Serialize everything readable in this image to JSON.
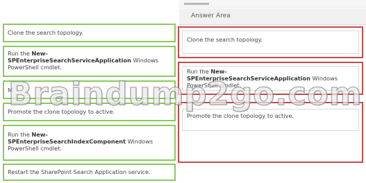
{
  "answer_area": {
    "title": "Answer Area"
  },
  "source_items": [
    {
      "lines": [
        "Clone the search topology."
      ]
    },
    {
      "line1_prefix": "Run the ",
      "line1_bold": "New-",
      "line2_bold": "SPEnterpriseSearchServiceApplication",
      "line2_rest": " Windows",
      "line3": "PowerShell cmdlet."
    },
    {
      "visible_text": "M"
    },
    {
      "lines": [
        "Promote the clone topology to active."
      ]
    },
    {
      "line1_prefix": "Run the ",
      "line1_bold": "New-",
      "line2_bold": "SPEnterpriseSearchIndexComponent",
      "line2_rest": " Windows",
      "line3": "PowerShell cmdlet."
    },
    {
      "lines": [
        "Restart the SharePoint Search Application service."
      ]
    }
  ],
  "answer_items": [
    {
      "lines": [
        "Clone the search topology."
      ]
    },
    {
      "line1_prefix": "Run the ",
      "line1_bold": "New-",
      "line2_bold": "SPEnterpriseSearchServiceApplication",
      "line2_rest": " Windows",
      "line3": "PowerShell cmdlet."
    },
    {
      "lines": [
        "Promote the clone topology to active."
      ]
    }
  ],
  "watermark": "Braindump2go.com",
  "colors": {
    "source_border": "#86cc5a",
    "answer_border": "#c54a4a"
  }
}
